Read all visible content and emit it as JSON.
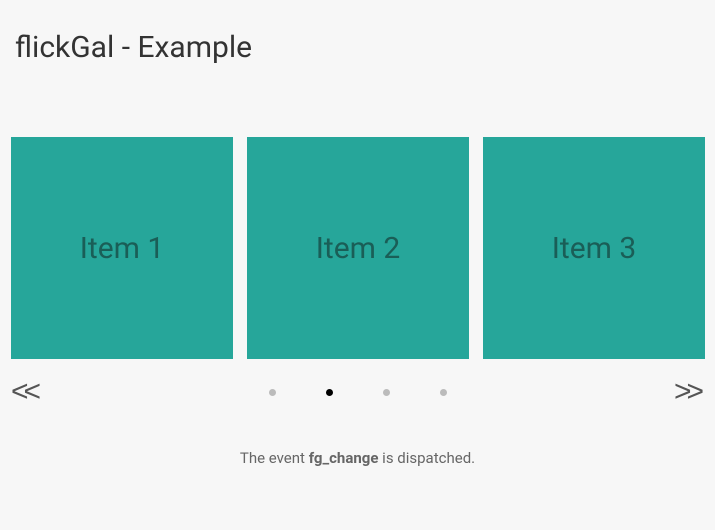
{
  "header": {
    "title": "flickGal - Example"
  },
  "carousel": {
    "items": [
      {
        "label": "Item 1"
      },
      {
        "label": "Item 2"
      },
      {
        "label": "Item 3"
      }
    ],
    "nav": {
      "prev": "<<",
      "next": ">>"
    },
    "dots": {
      "count": 4,
      "active_index": 1
    }
  },
  "status": {
    "prefix": "The event ",
    "event_name": "fg_change",
    "suffix": " is dispatched."
  }
}
